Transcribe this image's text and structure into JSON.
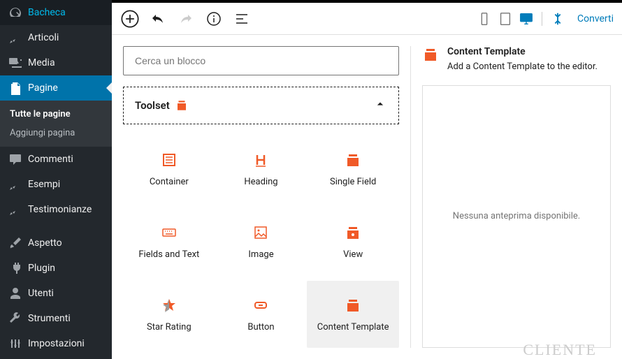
{
  "sidebar": {
    "items": [
      {
        "label": "Bacheca"
      },
      {
        "label": "Articoli"
      },
      {
        "label": "Media"
      },
      {
        "label": "Pagine"
      },
      {
        "label": "Commenti"
      },
      {
        "label": "Esempi"
      },
      {
        "label": "Testimonianze"
      },
      {
        "label": "Aspetto"
      },
      {
        "label": "Plugin"
      },
      {
        "label": "Utenti"
      },
      {
        "label": "Strumenti"
      },
      {
        "label": "Impostazioni"
      }
    ],
    "sub": {
      "all": "Tutte le pagine",
      "add": "Aggiungi pagina"
    }
  },
  "toolbar": {
    "convert": "Converti"
  },
  "inserter": {
    "search_placeholder": "Cerca un blocco",
    "category": "Toolset",
    "blocks": [
      {
        "label": "Container"
      },
      {
        "label": "Heading"
      },
      {
        "label": "Single Field"
      },
      {
        "label": "Fields and Text"
      },
      {
        "label": "Image"
      },
      {
        "label": "View"
      },
      {
        "label": "Star Rating"
      },
      {
        "label": "Button"
      },
      {
        "label": "Content Template"
      }
    ]
  },
  "detail": {
    "title": "Content Template",
    "desc": "Add a Content Template to the editor.",
    "preview": "Nessuna anteprima disponibile."
  },
  "bg": {
    "cliente": "CLIENTE"
  }
}
